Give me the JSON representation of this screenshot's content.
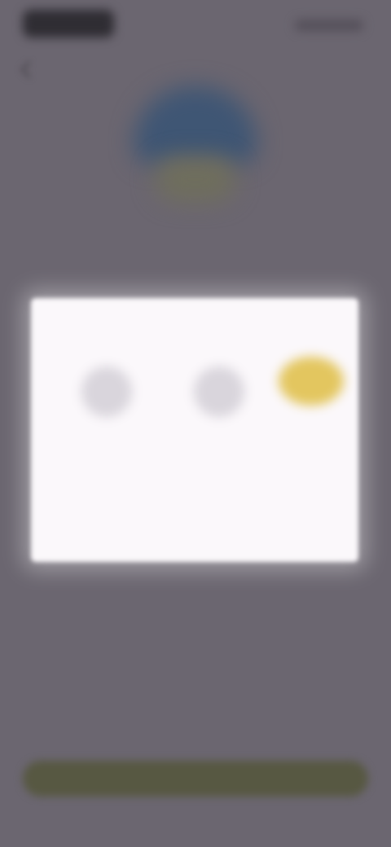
{
  "app": {
    "accent_color": "#575842",
    "background_color": "#6b6670",
    "card_color": "#fbf8fb"
  },
  "status_bar": {
    "time": "",
    "icons": "status-icons"
  },
  "navigation": {
    "back_icon": "chevron-left-icon"
  },
  "illustration": {
    "icon": "weather-illustration-icon"
  },
  "page": {
    "title": ""
  },
  "card": {
    "label": "",
    "options": [
      {
        "label": "",
        "icon": "option-icon",
        "selected": false
      },
      {
        "label": "",
        "icon": "option-icon",
        "selected": false
      },
      {
        "label": "",
        "icon": "option-icon",
        "selected": true,
        "highlight_color": "#e3c65f"
      }
    ],
    "links": [
      "",
      ""
    ]
  },
  "footer": {
    "primary_button_label": ""
  }
}
